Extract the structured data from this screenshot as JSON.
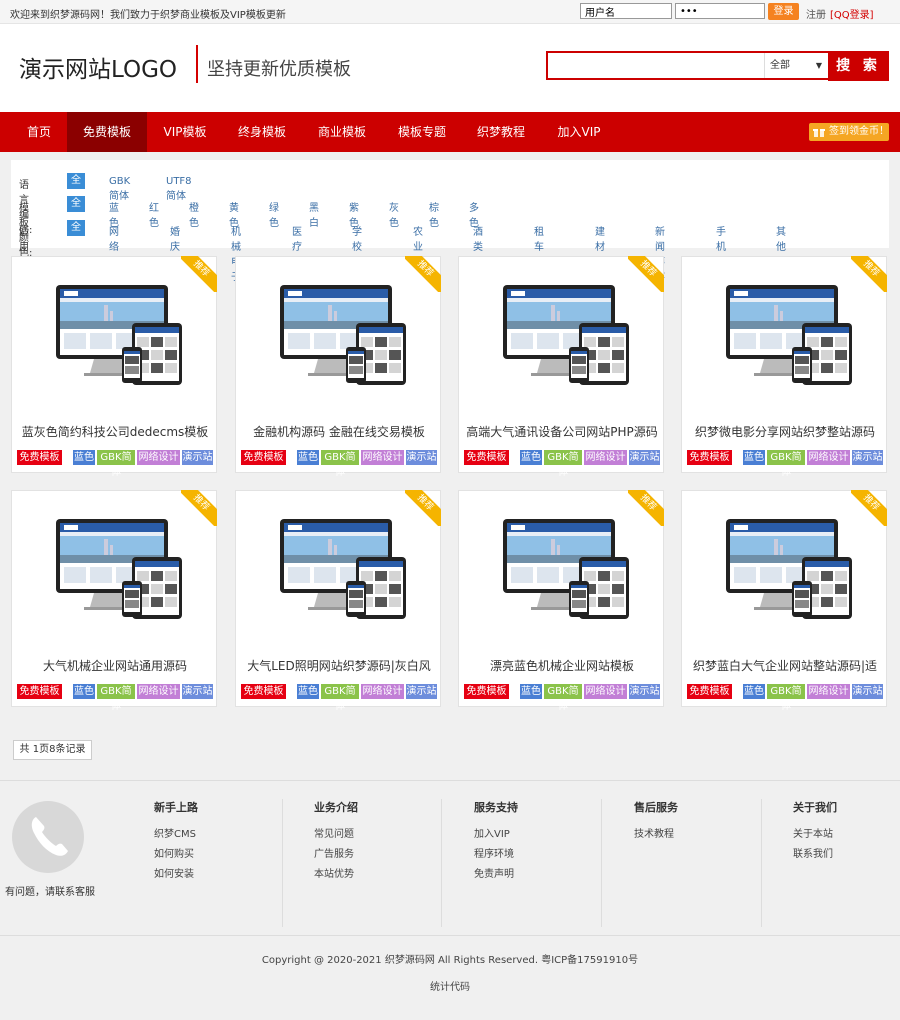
{
  "topbar": {
    "welcome": "欢迎来到织梦源码网！我们致力于织梦商业模板及VIP模板更新",
    "username_value": "用户名",
    "password_value": "•••",
    "login_label": "登录",
    "register_label": "注册",
    "qq_login_label": "[QQ登录]"
  },
  "header": {
    "logo": "演示网站LOGO",
    "slogan": "坚持更新优质模板",
    "search_value": "",
    "search_select": "全部",
    "search_button": "搜 索"
  },
  "nav": {
    "items": [
      "首页",
      "免费模板",
      "VIP模板",
      "终身模板",
      "商业模板",
      "模板专题",
      "织梦教程",
      "加入VIP"
    ],
    "active_index": 1,
    "signin_label": "签到领金币！"
  },
  "filter": {
    "rows": [
      {
        "label": "语言编码:",
        "options": [
          "全部",
          "GBK简体",
          "UTF8简体"
        ]
      },
      {
        "label": "模板颜色:",
        "options": [
          "全部",
          "蓝色",
          "红色",
          "橙色",
          "黄色",
          "绿色",
          "黑白",
          "紫色",
          "灰色",
          "棕色",
          "多色"
        ]
      },
      {
        "label": "适用站点:",
        "options": [
          "全部",
          "网络设计",
          "婚庆摄影",
          "机械电子",
          "医疗保健",
          "学校培训",
          "农业化工",
          "酒类食品",
          "租车金融",
          "建材装修",
          "新闻博客",
          "手机模板",
          "其他行业"
        ]
      }
    ]
  },
  "ribbon_label": "推荐",
  "products": [
    {
      "title": "蓝灰色简约科技公司dedecms模板",
      "tags": [
        "免费模板",
        "蓝色",
        "GBK简体",
        "网络设计",
        "演示站"
      ]
    },
    {
      "title": "金融机构源码 金融在线交易模板",
      "tags": [
        "免费模板",
        "蓝色",
        "GBK简体",
        "网络设计",
        "演示站"
      ]
    },
    {
      "title": "高端大气通讯设备公司网站PHP源码",
      "tags": [
        "免费模板",
        "蓝色",
        "GBK简体",
        "网络设计",
        "演示站"
      ]
    },
    {
      "title": "织梦微电影分享网站织梦整站源码",
      "tags": [
        "免费模板",
        "蓝色",
        "GBK简体",
        "网络设计",
        "演示站"
      ]
    },
    {
      "title": "大气机械企业网站通用源码",
      "tags": [
        "免费模板",
        "蓝色",
        "GBK简体",
        "网络设计",
        "演示站"
      ]
    },
    {
      "title": "大气LED照明网站织梦源码|灰白风",
      "tags": [
        "免费模板",
        "蓝色",
        "GBK简体",
        "网络设计",
        "演示站"
      ]
    },
    {
      "title": "漂亮蓝色机械企业网站模板",
      "tags": [
        "免费模板",
        "蓝色",
        "GBK简体",
        "网络设计",
        "演示站"
      ]
    },
    {
      "title": "织梦蓝白大气企业网站整站源码|适",
      "tags": [
        "免费模板",
        "蓝色",
        "GBK简体",
        "网络设计",
        "演示站"
      ]
    }
  ],
  "tag_colors": [
    "#e60012",
    "#4a7fd4",
    "#8bc34a",
    "#c27fd6",
    "#6d8ddc"
  ],
  "pager": {
    "text": "共 1页8条记录"
  },
  "footer": {
    "contact_text": "有问题，请联系客服",
    "columns": [
      {
        "title": "新手上路",
        "links": [
          "织梦CMS",
          "如何购买",
          "如何安装"
        ]
      },
      {
        "title": "业务介绍",
        "links": [
          "常见问题",
          "广告服务",
          "本站优势"
        ]
      },
      {
        "title": "服务支持",
        "links": [
          "加入VIP",
          "程序环境",
          "免责声明"
        ]
      },
      {
        "title": "售后服务",
        "links": [
          "技术教程"
        ]
      },
      {
        "title": "关于我们",
        "links": [
          "关于本站",
          "联系我们"
        ]
      }
    ],
    "copyright": "Copyright @ 2020-2021 织梦源码网 All Rights Reserved. 粤ICP备17591910号",
    "stats": "统计代码"
  },
  "colors": {
    "brand_red": "#cc0000",
    "nav_active": "#8b0000",
    "accent_orange": "#f58220",
    "filter_selected": "#3a8dd6"
  }
}
